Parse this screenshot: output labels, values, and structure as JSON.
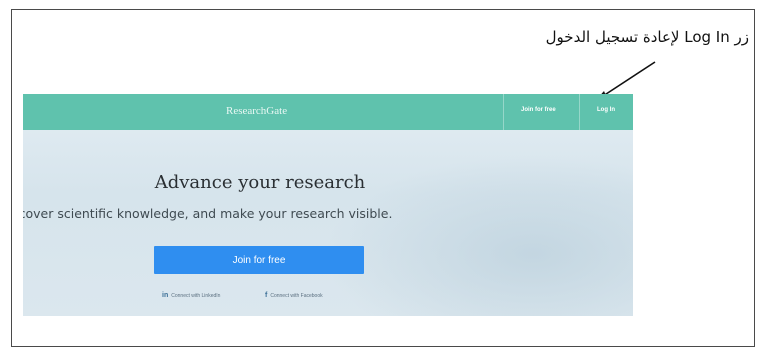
{
  "annotation": {
    "text": "زر Log In لإعادة تسجيل الدخول"
  },
  "site": {
    "brand": "ResearchGate",
    "nav": {
      "join_label": "Join for free",
      "login_label": "Log In"
    },
    "hero": {
      "title": "Advance your research",
      "subtitle": "Discover scientific knowledge, and make your research visible.",
      "join_button": "Join for free",
      "connect_linkedin": "Connect with LinkedIn",
      "connect_facebook": "Connect with Facebook"
    }
  },
  "colors": {
    "nav_bar": "#5fc2ad",
    "join_button": "#2f8ef0",
    "frame_border": "#4a4a4a"
  },
  "icons": {
    "linkedin": "linkedin-icon",
    "facebook": "facebook-icon"
  }
}
